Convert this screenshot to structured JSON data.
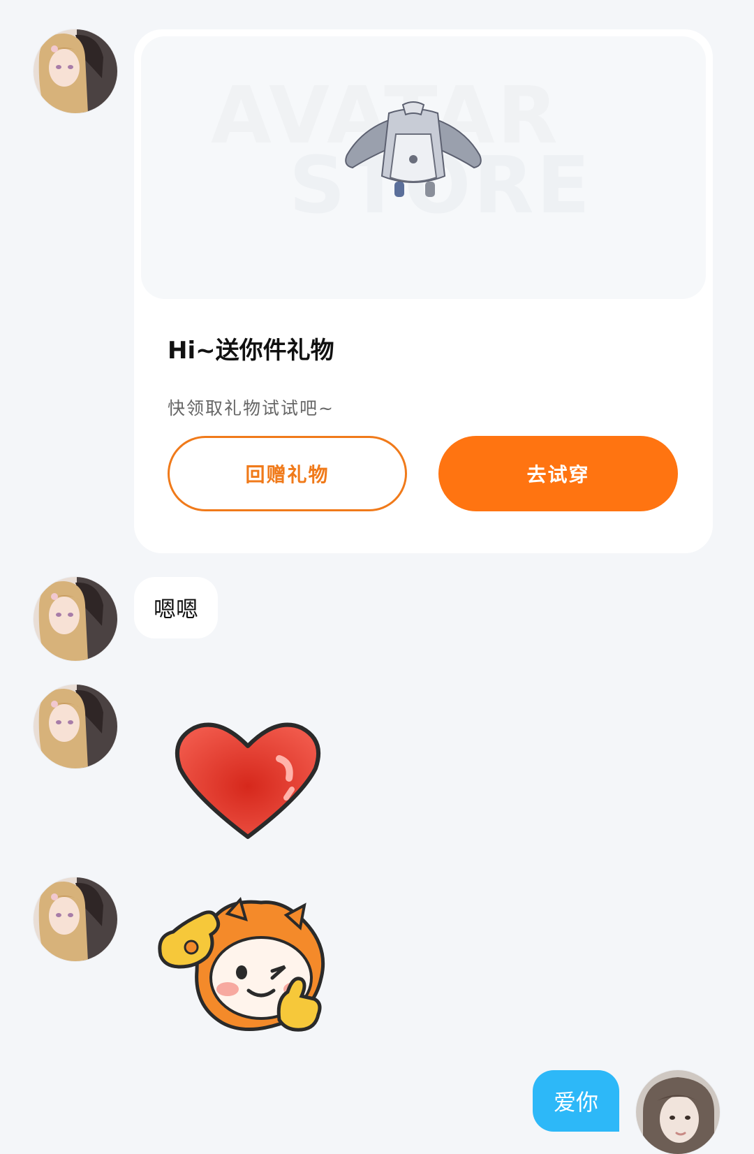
{
  "gift_card": {
    "watermark_line1": "AVATAR",
    "watermark_line2": "STORE",
    "title": "Hi~送你件礼物",
    "subtitle": "快领取礼物试试吧~",
    "return_gift_label": "回赠礼物",
    "try_on_label": "去试穿"
  },
  "messages": {
    "text_1": "嗯嗯",
    "sticker_heart": "heart-sticker",
    "sticker_ok": "wink-thumbs-up-sticker",
    "mine_text": "爱你"
  },
  "colors": {
    "accent_orange": "#ff7411",
    "my_bubble_blue": "#2db8f8",
    "background": "#f4f6f9"
  }
}
